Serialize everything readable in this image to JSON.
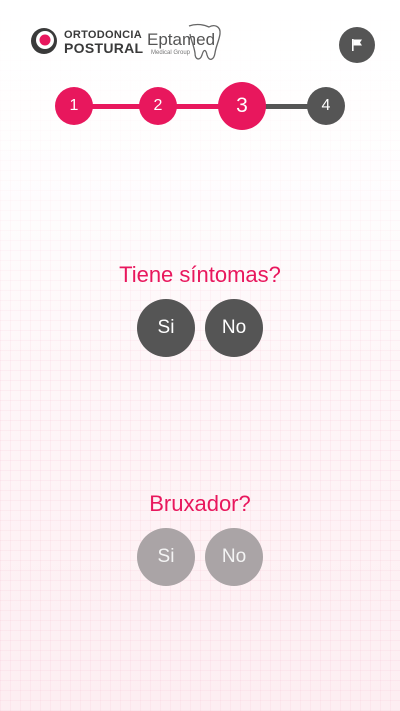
{
  "header": {
    "logo_primary": {
      "line1": "ORTODONCIA",
      "line2": "POSTURAL"
    },
    "logo_secondary": {
      "name": "Eptamed",
      "tagline": "Medical Group"
    },
    "flag_icon": "flag-icon"
  },
  "stepper": {
    "current": 3,
    "steps": [
      {
        "label": "1",
        "state": "done"
      },
      {
        "label": "2",
        "state": "done"
      },
      {
        "label": "3",
        "state": "current"
      },
      {
        "label": "4",
        "state": "pending"
      }
    ]
  },
  "questions": [
    {
      "text": "Tiene síntomas?",
      "yes_label": "Si",
      "no_label": "No",
      "enabled": true
    },
    {
      "text": "Bruxador?",
      "yes_label": "Si",
      "no_label": "No",
      "enabled": false
    }
  ],
  "colors": {
    "accent": "#e8175d",
    "dark": "#555555",
    "disabled": "#aaa4a6"
  }
}
